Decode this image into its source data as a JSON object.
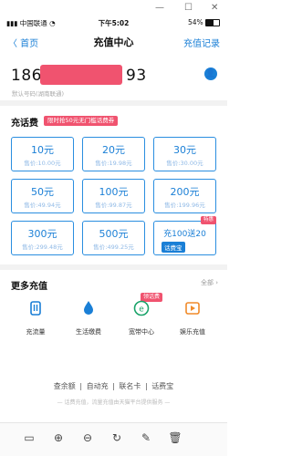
{
  "window": {
    "minimize": "—",
    "maximize": "☐",
    "close": "✕"
  },
  "status": {
    "carrier": "▮▮▮ 中国联通 ◔",
    "time": "下午5:02",
    "battery": "54%"
  },
  "nav": {
    "back": "〈 首页",
    "title": "充值中心",
    "record": "充值记录"
  },
  "phone": {
    "prefix": "186",
    "suffix": "93",
    "sub": "默认号码(湖南联通)"
  },
  "recharge": {
    "title": "充话费",
    "promo": "限时抢50元无门槛话费券",
    "cards": [
      {
        "amount": "10元",
        "price": "售价:10.00元"
      },
      {
        "amount": "20元",
        "price": "售价:19.98元"
      },
      {
        "amount": "30元",
        "price": "售价:30.00元"
      },
      {
        "amount": "50元",
        "price": "售价:49.94元"
      },
      {
        "amount": "100元",
        "price": "售价:99.87元"
      },
      {
        "amount": "200元",
        "price": "售价:199.96元"
      },
      {
        "amount": "300元",
        "price": "售价:299.48元"
      },
      {
        "amount": "500元",
        "price": "售价:499.25元"
      },
      {
        "amount": "充100送20",
        "price": "",
        "badge": "特惠",
        "logo": "话费宝"
      }
    ]
  },
  "more": {
    "title": "更多充值",
    "all": "全部 ›",
    "services": [
      {
        "label": "充流量",
        "icon": "data-icon"
      },
      {
        "label": "生活缴费",
        "icon": "utility-icon"
      },
      {
        "label": "宽带中心",
        "icon": "broadband-icon",
        "tag": "领话费"
      },
      {
        "label": "娱乐充值",
        "icon": "entertainment-icon"
      }
    ]
  },
  "footer": {
    "links": [
      "查余额",
      "|",
      "自动充",
      "|",
      "联名卡",
      "|",
      "话费宝"
    ],
    "note": "— 话费充值，流量充值由天猫平台提供服务 —"
  },
  "colors": {
    "accent": "#1a7fd6",
    "promo": "#f0536f"
  }
}
